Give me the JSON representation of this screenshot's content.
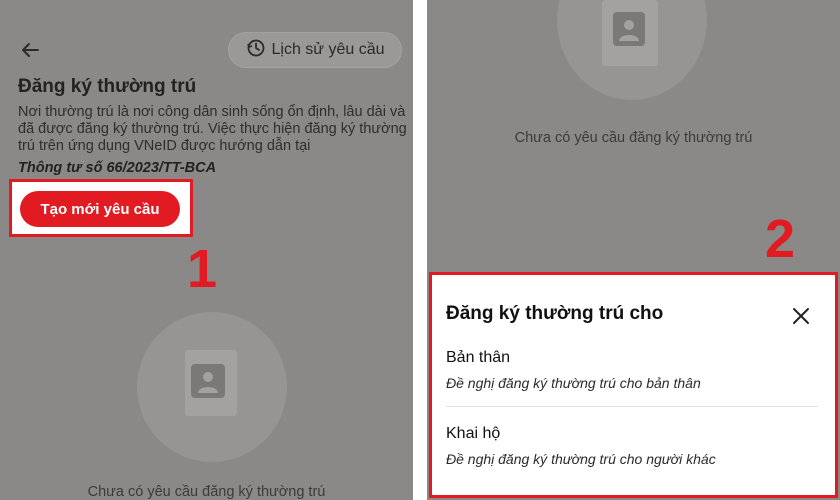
{
  "left": {
    "history_label": "Lịch sử yêu cầu",
    "title": "Đăng ký thường trú",
    "description": "Nơi thường trú là nơi công dân sinh sống ổn định, lâu dài và đã được đăng ký thường trú. Việc thực hiện đăng ký thường trú trên ứng dụng VNeID được hướng dẫn tại",
    "circular": "Thông tư số 66/2023/TT-BCA",
    "create_button": "Tạo mới yêu cầu",
    "step_number": "1",
    "empty_text": "Chưa có yêu cầu đăng ký thường trú"
  },
  "right": {
    "empty_text": "Chưa có yêu cầu đăng ký thường trú",
    "step_number": "2",
    "sheet": {
      "title": "Đăng ký thường trú cho",
      "options": [
        {
          "label": "Bản thân",
          "sub": "Đề nghị đăng ký thường trú cho bản thân"
        },
        {
          "label": "Khai hộ",
          "sub": "Đề nghị đăng ký thường trú cho người khác"
        }
      ]
    }
  },
  "colors": {
    "accent": "#e21b22",
    "overlay": "#8a8987"
  },
  "icons": [
    "back-arrow-icon",
    "history-clock-icon",
    "document-avatar-icon",
    "close-icon"
  ]
}
